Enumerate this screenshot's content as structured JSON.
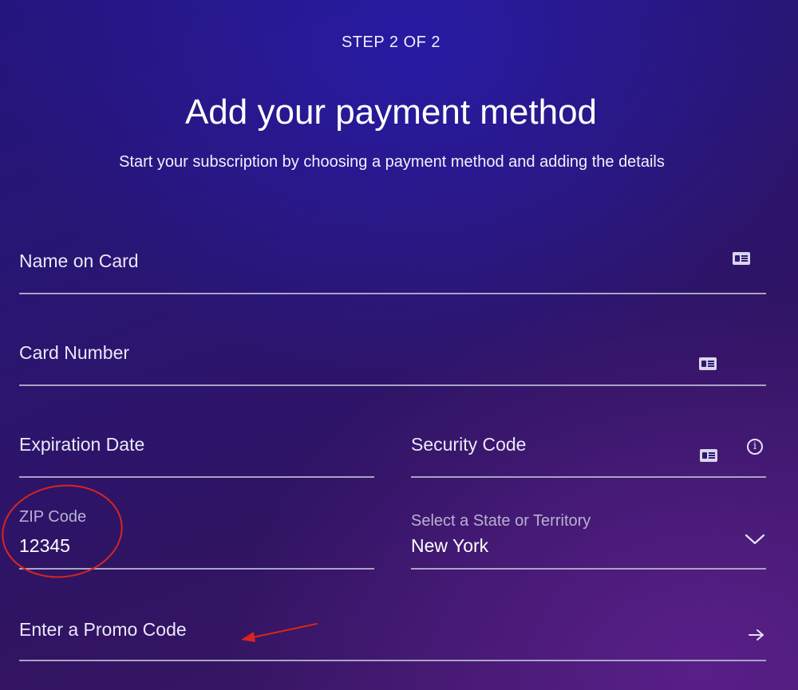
{
  "header": {
    "step": "STEP 2 OF 2",
    "title": "Add your payment method",
    "subtitle": "Start your subscription by choosing a payment method and adding the details"
  },
  "form": {
    "name_on_card": {
      "placeholder": "Name on Card"
    },
    "card_number": {
      "placeholder": "Card Number"
    },
    "expiration_date": {
      "placeholder": "Expiration Date"
    },
    "security_code": {
      "placeholder": "Security Code"
    },
    "zip_code": {
      "label": "ZIP Code",
      "value": "12345"
    },
    "state": {
      "label": "Select a State or Territory",
      "value": "New York"
    },
    "promo_code": {
      "placeholder": "Enter a Promo Code"
    }
  },
  "icons": {
    "name_on_card": "card-icon",
    "card_number": "card-icon",
    "security_code": "card-icon",
    "security_info": "info-icon",
    "state_dropdown": "chevron-down-icon",
    "promo_submit": "arrow-right-icon"
  },
  "colors": {
    "annotation": "#d9251d",
    "underline": "#a9a3c4"
  }
}
